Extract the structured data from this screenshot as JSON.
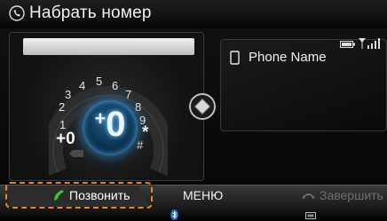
{
  "header": {
    "title": "Набрать номер",
    "icon": "phone-handset-icon"
  },
  "dialer": {
    "number_value": "",
    "center_digit": "0",
    "center_prefix": "+",
    "digits": [
      "1",
      "2",
      "3",
      "4",
      "5",
      "6",
      "7",
      "8",
      "9",
      "*",
      "#"
    ],
    "plus_zero_label": "+0"
  },
  "device": {
    "name": "Phone Name"
  },
  "softkeys": {
    "call_label": "Позвонить",
    "menu_label": "МЕНЮ",
    "end_label": "Завершить"
  },
  "colors": {
    "accent_highlight": "#e1872c",
    "call_green": "#38c23a",
    "dial_blue": "#2a8ad0"
  }
}
